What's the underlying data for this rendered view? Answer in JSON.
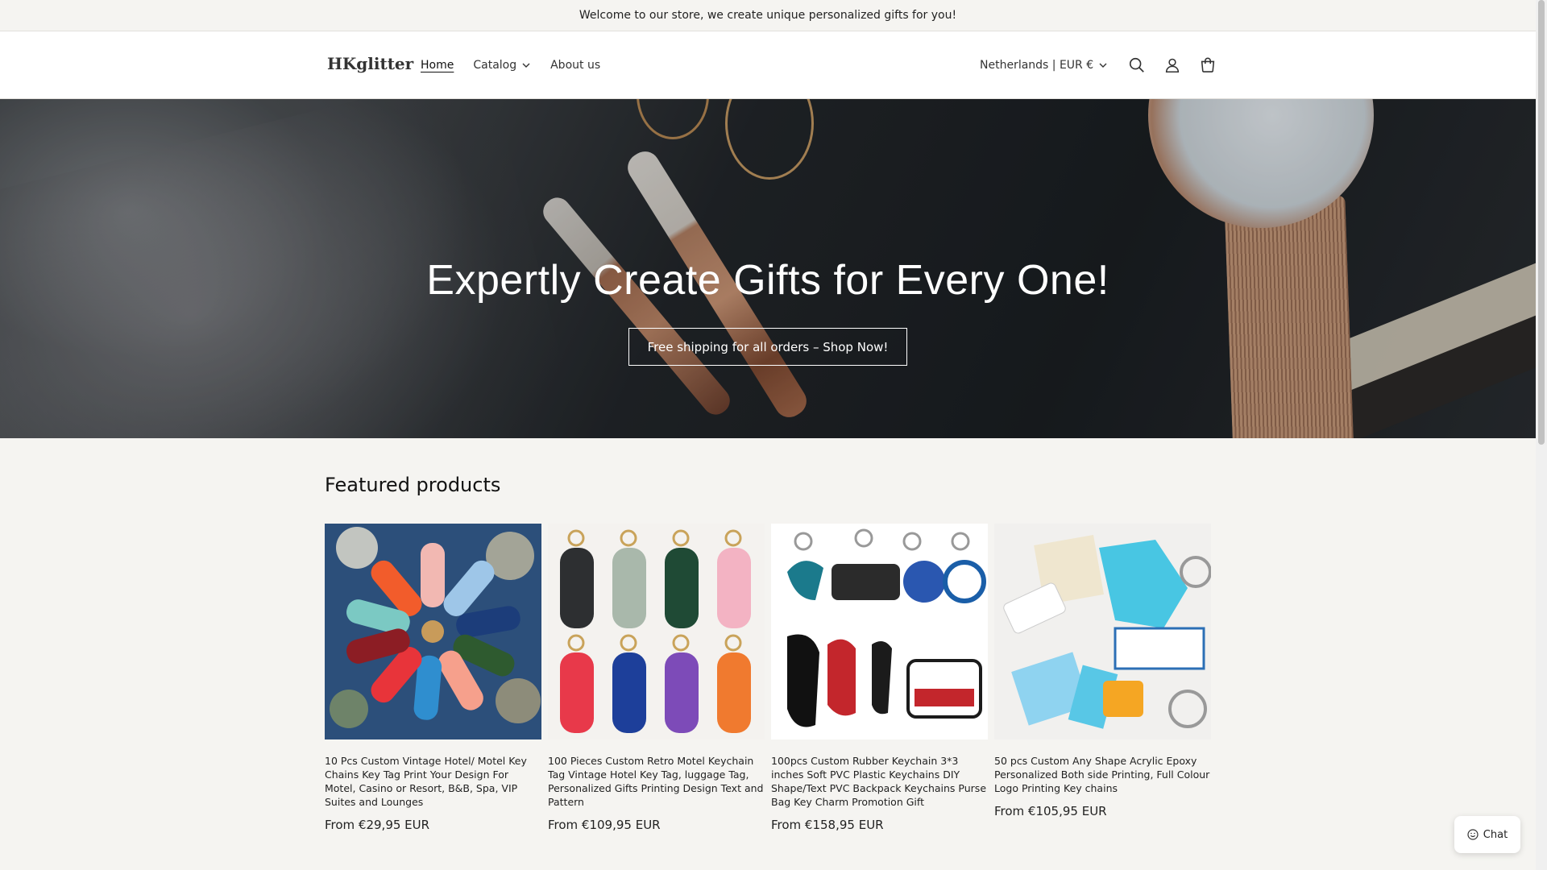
{
  "announcement": "Welcome to our store, we create unique personalized gifts for you!",
  "header": {
    "logo": "HKglitter",
    "nav": [
      {
        "label": "Home",
        "active": true
      },
      {
        "label": "Catalog",
        "has_dropdown": true
      },
      {
        "label": "About us"
      }
    ],
    "locale": "Netherlands | EUR €",
    "icons": [
      "search-icon",
      "account-icon",
      "cart-icon"
    ]
  },
  "hero": {
    "title": "Expertly Create Gifts for Every One!",
    "button": "Free shipping for all orders – Shop Now!"
  },
  "featured": {
    "title": "Featured products",
    "products": [
      {
        "title": "10 Pcs Custom Vintage Hotel/ Motel Key Chains Key Tag Print Your Design For Motel, Casino or Resort, B&B, Spa, VIP Suites and Lounges",
        "price": "From €29,95 EUR"
      },
      {
        "title": "100 Pieces Custom Retro Motel Keychain Tag Vintage Hotel Key Tag, luggage Tag, Personalized Gifts Printing Design Text and Pattern",
        "price": "From €109,95 EUR"
      },
      {
        "title": "100pcs Custom Rubber Keychain 3*3 inches Soft PVC Plastic Keychains DIY Shape/Text PVC Backpack Keychains Purse Bag Key Charm Promotion Gift",
        "price": "From €158,95 EUR"
      },
      {
        "title": "50 pcs Custom Any Shape Acrylic Epoxy Personalized Both side Printing, Full Colour Logo Printing Key chains",
        "price": "From €105,95 EUR"
      }
    ]
  },
  "chat": {
    "label": "Chat",
    "icon": "smile-icon"
  },
  "colors": {
    "background": "#f5f4f1",
    "header": "#ffffff",
    "text": "#121212"
  }
}
